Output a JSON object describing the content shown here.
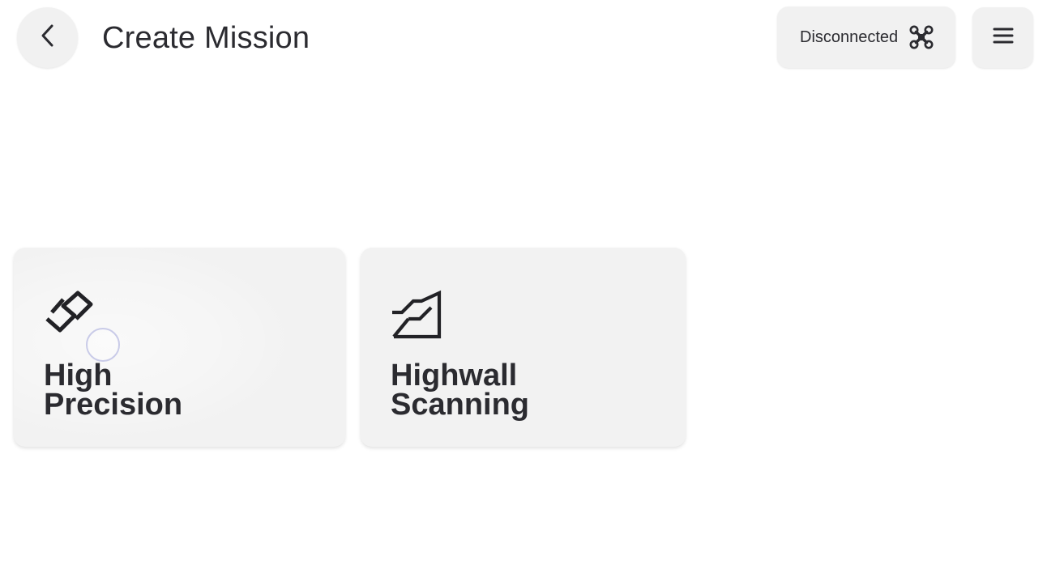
{
  "header": {
    "title": "Create Mission",
    "back_icon": "chevron-left-icon",
    "connection_status": "Disconnected",
    "status_icon": "drone-icon",
    "menu_icon": "hamburger-menu-icon"
  },
  "missions": [
    {
      "line1": "High",
      "line2": "Precision",
      "icon": "zigzag-path-icon",
      "state": "pressed"
    },
    {
      "line1": "Highwall",
      "line2": "Scanning",
      "icon": "highwall-slope-icon"
    }
  ],
  "colors": {
    "background": "#ffffff",
    "surface": "#f2f2f2",
    "text": "#2b2b30",
    "ripple_ring": "#c9cbe8"
  }
}
